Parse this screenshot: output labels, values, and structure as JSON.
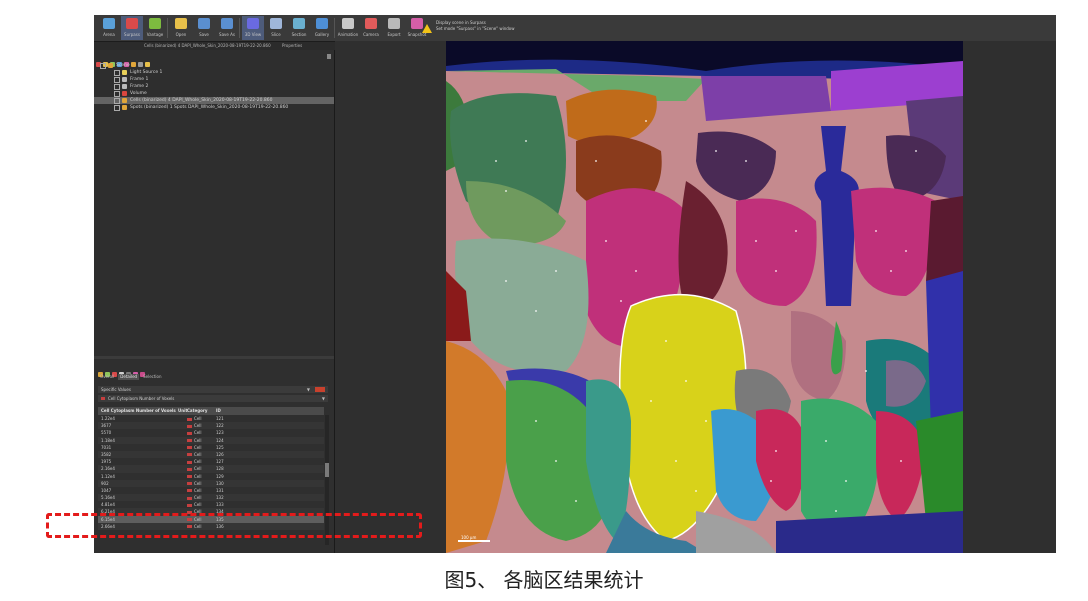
{
  "toolbar": {
    "buttons": [
      {
        "label": "Arena",
        "icon": "arena-icon",
        "color": "#5aa0d8"
      },
      {
        "label": "Surpass",
        "icon": "surpass-icon",
        "color": "#d94a4a",
        "active": true
      },
      {
        "label": "Vantage",
        "icon": "vantage-icon",
        "color": "#7dbb3f"
      },
      {
        "label": "Open",
        "icon": "open-folder-icon",
        "color": "#e7c04a"
      },
      {
        "label": "Save",
        "icon": "save-icon",
        "color": "#5a8fd0"
      },
      {
        "label": "Save As",
        "icon": "save-as-icon",
        "color": "#5a8fd0"
      },
      {
        "label": "3D View",
        "icon": "3d-view-icon",
        "color": "#6a6ae0",
        "active": true
      },
      {
        "label": "Slice",
        "icon": "slice-icon",
        "color": "#9fb6d9"
      },
      {
        "label": "Section",
        "icon": "section-icon",
        "color": "#6ab0d0"
      },
      {
        "label": "Gallery",
        "icon": "gallery-icon",
        "color": "#4e8fd6"
      },
      {
        "label": "Animation",
        "icon": "animation-icon",
        "color": "#c9c9c9"
      },
      {
        "label": "Camera",
        "icon": "camera-icon",
        "color": "#e25b5b"
      },
      {
        "label": "Export",
        "icon": "export-icon",
        "color": "#b9b9b9"
      },
      {
        "label": "Snapshot",
        "icon": "snapshot-icon",
        "color": "#d45ea8"
      }
    ],
    "warning_line1": "Display scene in Surpass",
    "warning_line2": "Set mode \"Surpass\" in \"Scene\" window"
  },
  "info_line": {
    "left": "Cells (binarized) 4 DAPI_Whole_Skin_2020-08-19T19-22-20.860",
    "right": "Properties"
  },
  "tree": {
    "items": [
      {
        "label": "Scene",
        "level": 0,
        "icon": "scene-icon",
        "color": "#e0a63a"
      },
      {
        "label": "Light Source 1",
        "level": 1,
        "icon": "light-icon",
        "color": "#e8d05a"
      },
      {
        "label": "Frame 1",
        "level": 1,
        "icon": "frame-icon",
        "color": "#b9b9b9"
      },
      {
        "label": "Frame 2",
        "level": 1,
        "icon": "frame-icon",
        "color": "#b9b9b9"
      },
      {
        "label": "Volume",
        "level": 1,
        "icon": "volume-icon",
        "color": "#d9473f"
      },
      {
        "label": "Cells (binarized) 4 DAPI_Whole_Skin_2020-08-19T19-22-20.860",
        "level": 1,
        "icon": "cells-icon",
        "color": "#e0a63a",
        "selected": true
      },
      {
        "label": "Spots (binarized) 1 Spots DAPI_Whole_Skin_2020-08-19T19-22-20.860",
        "level": 1,
        "icon": "spots-icon",
        "color": "#e0a63a"
      }
    ]
  },
  "stats": {
    "tabs": [
      {
        "label": "Overall",
        "on": false
      },
      {
        "label": "Detailed",
        "on": true
      },
      {
        "label": "Selection",
        "on": false
      }
    ],
    "dropdown1": "Specific Values",
    "dropdown2": "Cell Cytoplasm Number of Voxels",
    "columns": [
      "Cell Cytoplasm Number of Voxels",
      "Unit",
      "Category",
      "ID"
    ],
    "rows": [
      {
        "value": "1.22e4",
        "unit": "",
        "category": "Cell",
        "id": "121"
      },
      {
        "value": "3677",
        "unit": "",
        "category": "Cell",
        "id": "122"
      },
      {
        "value": "5570",
        "unit": "",
        "category": "Cell",
        "id": "123"
      },
      {
        "value": "1.18e4",
        "unit": "",
        "category": "Cell",
        "id": "124"
      },
      {
        "value": "7031",
        "unit": "",
        "category": "Cell",
        "id": "125"
      },
      {
        "value": "3582",
        "unit": "",
        "category": "Cell",
        "id": "126"
      },
      {
        "value": "1975",
        "unit": "",
        "category": "Cell",
        "id": "127"
      },
      {
        "value": "2.16e4",
        "unit": "",
        "category": "Cell",
        "id": "128"
      },
      {
        "value": "1.12e4",
        "unit": "",
        "category": "Cell",
        "id": "129"
      },
      {
        "value": "902",
        "unit": "",
        "category": "Cell",
        "id": "130"
      },
      {
        "value": "1047",
        "unit": "",
        "category": "Cell",
        "id": "131"
      },
      {
        "value": "5.16e4",
        "unit": "",
        "category": "Cell",
        "id": "132"
      },
      {
        "value": "4.81e4",
        "unit": "",
        "category": "Cell",
        "id": "133"
      },
      {
        "value": "6.21e4",
        "unit": "",
        "category": "Cell",
        "id": "134"
      },
      {
        "value": "6.15e4",
        "unit": "",
        "category": "Cell",
        "id": "135",
        "selected": true
      },
      {
        "value": "2.66e4",
        "unit": "",
        "category": "Cell",
        "id": "136"
      }
    ]
  },
  "viewport": {
    "scalebar_label": "100 µm"
  },
  "caption": "图5、 各脑区结果统计",
  "colors": {
    "highlight_box": "#e31b1b",
    "app_bg": "#2b2b2b"
  }
}
